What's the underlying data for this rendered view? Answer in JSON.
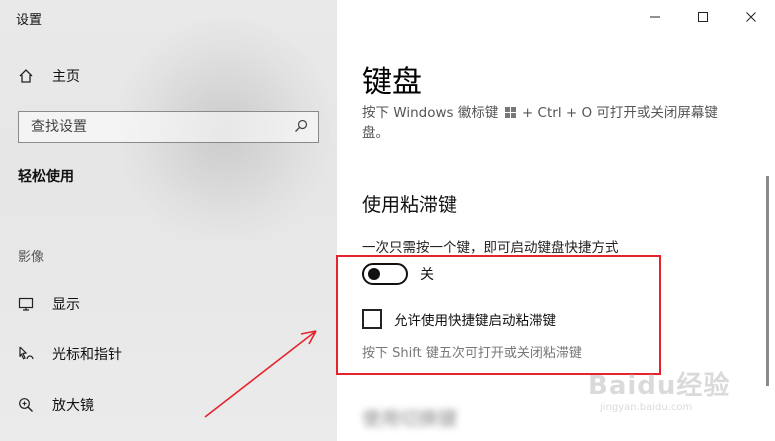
{
  "window": {
    "title": "设置",
    "controls": [
      "minimize",
      "maximize",
      "close"
    ]
  },
  "sidebar": {
    "home_label": "主页",
    "search_placeholder": "查找设置",
    "section_title": "轻松使用",
    "group_label": "影像",
    "items": [
      {
        "label": "显示",
        "icon": "monitor-icon"
      },
      {
        "label": "光标和指针",
        "icon": "cursor-icon"
      },
      {
        "label": "放大镜",
        "icon": "magnifier-icon"
      }
    ]
  },
  "main": {
    "title": "键盘",
    "description_part1": "按下 Windows 徽标键",
    "description_part2": "+ Ctrl + O 可打开或关闭屏幕键盘。",
    "sticky_keys": {
      "heading": "使用粘滞键",
      "description": "一次只需按一个键，即可启动键盘快捷方式",
      "toggle_state": "关",
      "toggle_on": false,
      "checkbox_label": "允许使用快捷键启动粘滞键",
      "checkbox_checked": false,
      "hint": "按下 Shift 键五次可打开或关闭粘滞键"
    },
    "next_heading": "使用切换键"
  },
  "annotation": {
    "box_color": "#e5232d",
    "arrow_color": "#e5232d"
  },
  "watermark": {
    "text": "Baidu经验",
    "sub": "jingyan.baidu.com"
  }
}
